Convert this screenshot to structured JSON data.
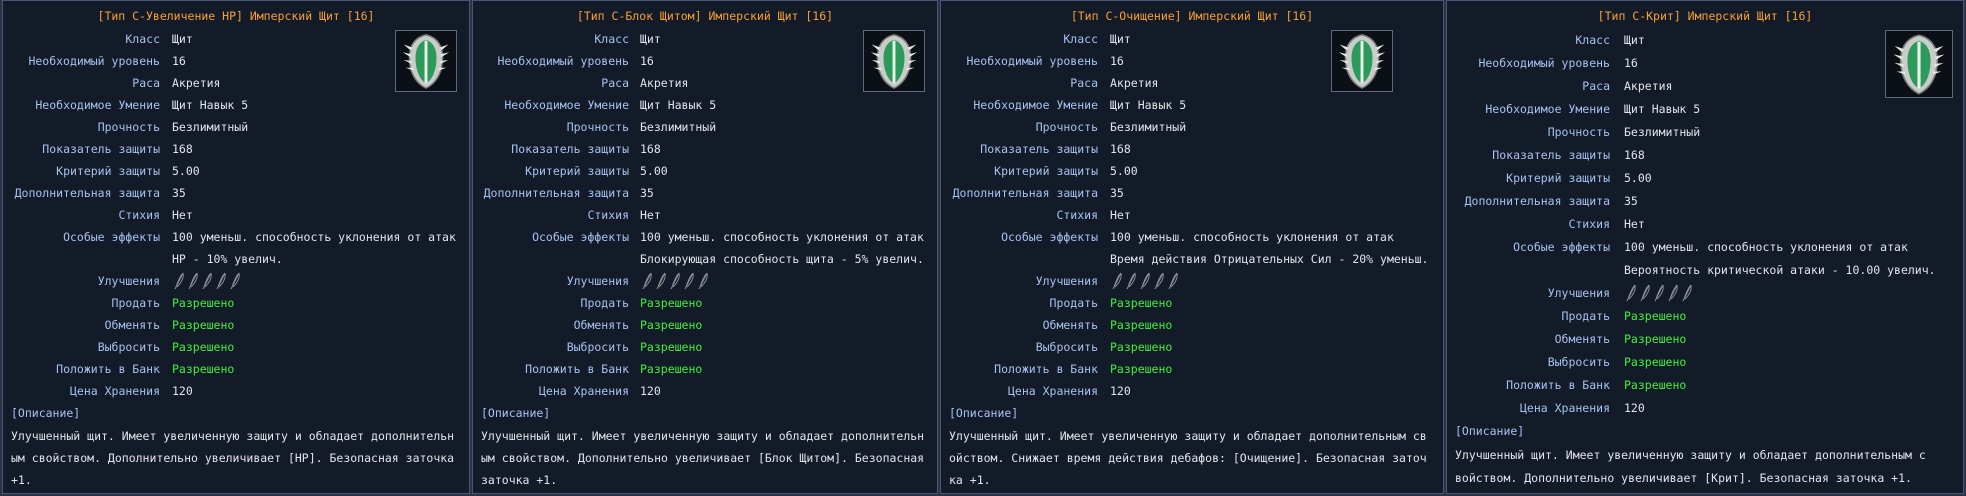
{
  "colors": {
    "page_bg": "#2b3446",
    "panel_bg": "#141b28",
    "panel_border": "#4a5674",
    "title": "#f5a033",
    "label": "#a5c2f0",
    "value": "#e2e4ea",
    "allowed": "#3ef23a"
  },
  "icons": {
    "item": "imperial-shield-icon",
    "upgrade_slot": "feather-upgrade-slot-icon"
  },
  "labels": {
    "class": "Класс",
    "level": "Необходимый уровень",
    "race": "Раса",
    "skill": "Необходимое Умение",
    "durability": "Прочность",
    "defense": "Показатель защиты",
    "def_crit": "Критерий защиты",
    "extra_def": "Дополнительная защита",
    "element": "Стихия",
    "effects": "Особые эффекты",
    "upgrades": "Улучшения",
    "sell": "Продать",
    "trade": "Обменять",
    "drop": "Выбросить",
    "bank": "Положить в Банк",
    "storage_price": "Цена Хранения",
    "description": "[Описание]"
  },
  "panels": [
    {
      "title": "[Тип C-Увеличение HP] Имперский Щит [16]",
      "class": "Щит",
      "level": "16",
      "race": "Акретия",
      "skill": "Щит Навык 5",
      "durability": "Безлимитный",
      "defense": "168",
      "def_crit": "5.00",
      "extra_def": "35",
      "element": "Нет",
      "effect1": "100 уменьш. способность уклонения от атак",
      "effect2": "HP - 10% увелич.",
      "sell": "Разрешено",
      "trade": "Разрешено",
      "drop": "Разрешено",
      "bank": "Разрешено",
      "storage_price": "120",
      "desc_lines": [
        "Улучшенный щит. Имеет увеличенную защиту и обладает дополнительн",
        "ым свойством. Дополнительно увеличивает [HP]. Безопасная заточка",
        " +1."
      ]
    },
    {
      "title": "[Тип C-Блок Щитом] Имперский Щит [16]",
      "class": "Щит",
      "level": "16",
      "race": "Акретия",
      "skill": "Щит Навык 5",
      "durability": "Безлимитный",
      "defense": "168",
      "def_crit": "5.00",
      "extra_def": "35",
      "element": "Нет",
      "effect1": "100 уменьш. способность уклонения от атак",
      "effect2": "Блокирующая способность щита - 5% увелич.",
      "sell": "Разрешено",
      "trade": "Разрешено",
      "drop": "Разрешено",
      "bank": "Разрешено",
      "storage_price": "120",
      "desc_lines": [
        "Улучшенный щит. Имеет увеличенную защиту и обладает дополнительн",
        "ым свойством. Дополнительно увеличивает [Блок Щитом]. Безопасная",
        " заточка +1."
      ]
    },
    {
      "title": "[Тип C-Очищение] Имперский Щит [16]",
      "class": "Щит",
      "level": "16",
      "race": "Акретия",
      "skill": "Щит Навык 5",
      "durability": "Безлимитный",
      "defense": "168",
      "def_crit": "5.00",
      "extra_def": "35",
      "element": "Нет",
      "effect1": "100 уменьш. способность уклонения от атак",
      "effect2": "Время действия Отрицательных Сил - 20% уменьш.",
      "sell": "Разрешено",
      "trade": "Разрешено",
      "drop": "Разрешено",
      "bank": "Разрешено",
      "storage_price": "120",
      "desc_lines": [
        "Улучшенный щит. Имеет увеличенную защиту и обладает дополнительным св",
        "ойством. Снижает время действия дебафов: [Очищение]. Безопасная заточ",
        "ка +1."
      ]
    },
    {
      "title": "[Тип C-Крит] Имперский Щит [16]",
      "class": "Щит",
      "level": "16",
      "race": "Акретия",
      "skill": "Щит Навык 5",
      "durability": "Безлимитный",
      "defense": "168",
      "def_crit": "5.00",
      "extra_def": "35",
      "element": "Нет",
      "effect1": "100 уменьш. способность уклонения от атак",
      "effect2": "Вероятность критической атаки - 10.00 увелич.",
      "sell": "Разрешено",
      "trade": "Разрешено",
      "drop": "Разрешено",
      "bank": "Разрешено",
      "storage_price": "120",
      "desc_lines": [
        "Улучшенный щит. Имеет увеличенную защиту и обладает дополнительным с",
        "войством. Дополнительно увеличивает [Крит]. Безопасная заточка +1."
      ]
    }
  ]
}
